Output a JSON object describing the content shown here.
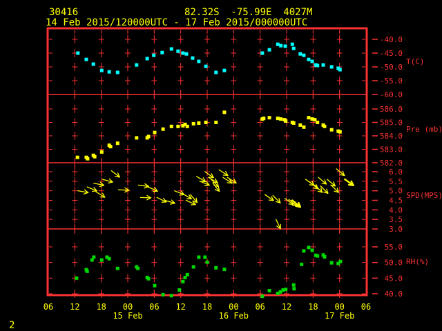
{
  "header": {
    "station_id": "30416",
    "location": "82.32S  -75.99E  4027M",
    "period": "14 Feb 2015/120000UTC - 17 Feb 2015/000000UTC"
  },
  "footer": {
    "page_label": "2"
  },
  "colors": {
    "background": "#000000",
    "axis": "#fa3232",
    "text": "#ffff00",
    "temperature": "#00ffff",
    "pressure": "#ffff00",
    "wind": "#ffff00",
    "rh": "#00d800"
  },
  "x_axis": {
    "hour_start": 6,
    "hour_end": 78,
    "hour_step": 6,
    "tick_labels": [
      "06",
      "12",
      "18",
      "00",
      "06",
      "12",
      "18",
      "00",
      "06",
      "12",
      "18",
      "00",
      "06"
    ],
    "date_labels": [
      {
        "label": "15 Feb",
        "hour": 24
      },
      {
        "label": "16 Feb",
        "hour": 48
      },
      {
        "label": "17 Feb",
        "hour": 72
      }
    ]
  },
  "chart_data": [
    {
      "type": "scatter",
      "name": "temperature",
      "label": "T(C)",
      "color_key": "temperature",
      "units": "deg C",
      "x_unit": "hours since 14 Feb 2015 00UTC",
      "tick_values": [
        -40,
        -45,
        -50,
        -55,
        -60
      ],
      "tick_labels": [
        "-40.0",
        "-45.0",
        "-50.0",
        "-55.0",
        "-60.0"
      ],
      "points": [
        [
          12.7,
          -45.0
        ],
        [
          14.6,
          -47.3
        ],
        [
          16.2,
          -49.0
        ],
        [
          18.1,
          -51.3
        ],
        [
          19.8,
          -51.8
        ],
        [
          21.7,
          -52.0
        ],
        [
          26.0,
          -49.3
        ],
        [
          28.4,
          -47.0
        ],
        [
          29.9,
          -45.8
        ],
        [
          31.8,
          -44.8
        ],
        [
          33.9,
          -43.5
        ],
        [
          35.4,
          -44.3
        ],
        [
          36.5,
          -45.0
        ],
        [
          37.3,
          -45.3
        ],
        [
          38.7,
          -46.8
        ],
        [
          40.1,
          -48.0
        ],
        [
          41.7,
          -49.8
        ],
        [
          44.0,
          -52.0
        ],
        [
          45.9,
          -51.3
        ],
        [
          54.5,
          -45.0
        ],
        [
          56.1,
          -43.8
        ],
        [
          58.0,
          -41.8
        ],
        [
          58.7,
          -42.3
        ],
        [
          59.7,
          -42.5
        ],
        [
          61.3,
          -41.8
        ],
        [
          61.6,
          -43.3
        ],
        [
          63.1,
          -45.3
        ],
        [
          63.9,
          -45.8
        ],
        [
          65.0,
          -47.3
        ],
        [
          65.8,
          -48.0
        ],
        [
          66.6,
          -49.3
        ],
        [
          67.0,
          -49.5
        ],
        [
          68.3,
          -49.3
        ],
        [
          70.2,
          -50.0
        ],
        [
          71.7,
          -50.5
        ],
        [
          72.1,
          -51.0
        ]
      ]
    },
    {
      "type": "scatter",
      "name": "pressure",
      "label": "Pre (mb)",
      "color_key": "pressure",
      "units": "mb",
      "x_unit": "hours since 14 Feb 2015 00UTC",
      "tick_values": [
        586,
        585,
        584,
        583,
        582
      ],
      "tick_labels": [
        "586.0",
        "585.0",
        "584.0",
        "583.0",
        "582.0"
      ],
      "points": [
        [
          12.6,
          582.4
        ],
        [
          14.6,
          582.4
        ],
        [
          14.9,
          582.3
        ],
        [
          16.2,
          582.55
        ],
        [
          16.5,
          582.45
        ],
        [
          18.1,
          582.8
        ],
        [
          19.8,
          583.3
        ],
        [
          20.1,
          583.2
        ],
        [
          21.7,
          583.45
        ],
        [
          26.0,
          583.85
        ],
        [
          28.4,
          583.85
        ],
        [
          28.7,
          583.95
        ],
        [
          30.1,
          584.25
        ],
        [
          32.0,
          584.5
        ],
        [
          33.9,
          584.7
        ],
        [
          35.4,
          584.7
        ],
        [
          36.5,
          584.75
        ],
        [
          37.0,
          584.85
        ],
        [
          37.5,
          584.7
        ],
        [
          38.9,
          584.9
        ],
        [
          40.1,
          584.95
        ],
        [
          41.7,
          585.0
        ],
        [
          44.0,
          585.0
        ],
        [
          45.9,
          585.75
        ],
        [
          54.5,
          585.25
        ],
        [
          54.8,
          585.3
        ],
        [
          56.1,
          585.35
        ],
        [
          58.0,
          585.3
        ],
        [
          58.7,
          585.25
        ],
        [
          59.5,
          585.2
        ],
        [
          59.8,
          585.1
        ],
        [
          61.3,
          585.0
        ],
        [
          61.6,
          584.95
        ],
        [
          63.1,
          584.8
        ],
        [
          63.9,
          584.65
        ],
        [
          65.0,
          585.35
        ],
        [
          65.8,
          585.25
        ],
        [
          66.4,
          585.2
        ],
        [
          67.0,
          585.0
        ],
        [
          68.3,
          584.8
        ],
        [
          68.6,
          584.7
        ],
        [
          70.2,
          584.45
        ],
        [
          71.7,
          584.35
        ],
        [
          72.1,
          584.3
        ]
      ]
    },
    {
      "type": "quiver",
      "name": "wind_speed",
      "label": "SPD(MPS)",
      "color_key": "wind",
      "units": "m/s",
      "x_unit": "hours since 14 Feb 2015 00UTC",
      "angle_unit": "degrees clockwise from screen-right",
      "tick_values": [
        6,
        5.5,
        5,
        4.5,
        4,
        3.5,
        3
      ],
      "tick_labels": [
        "6.0",
        "5.5",
        "5.0",
        "4.5",
        "4.0",
        "3.5",
        "3.0"
      ],
      "arrows": [
        [
          12.7,
          5.0,
          10,
          0
        ],
        [
          14.8,
          5.2,
          22,
          0
        ],
        [
          16.3,
          5.4,
          12,
          0
        ],
        [
          16.8,
          4.95,
          32,
          0
        ],
        [
          18.3,
          5.6,
          15,
          0
        ],
        [
          20.3,
          6.05,
          38,
          0
        ],
        [
          21.9,
          5.05,
          2,
          0
        ],
        [
          26.4,
          5.3,
          8,
          0
        ],
        [
          26.9,
          4.65,
          2,
          0
        ],
        [
          28.6,
          5.2,
          24,
          0
        ],
        [
          30.6,
          4.65,
          26,
          0
        ],
        [
          32.4,
          4.5,
          16,
          0
        ],
        [
          34.6,
          5.0,
          22,
          0
        ],
        [
          36.4,
          4.85,
          30,
          0
        ],
        [
          37.2,
          4.5,
          24,
          0
        ],
        [
          38.2,
          4.8,
          50,
          0
        ],
        [
          39.6,
          5.75,
          30,
          0
        ],
        [
          40.3,
          5.5,
          22,
          0
        ],
        [
          41.5,
          6.0,
          35,
          0
        ],
        [
          42.3,
          5.7,
          30,
          0
        ],
        [
          42.9,
          5.6,
          45,
          0
        ],
        [
          43.3,
          5.4,
          52,
          0
        ],
        [
          44.7,
          6.1,
          33,
          0
        ],
        [
          45.6,
          5.7,
          33,
          0
        ],
        [
          46.6,
          5.7,
          33,
          0
        ],
        [
          55.1,
          4.8,
          35,
          0
        ],
        [
          56.9,
          4.75,
          45,
          0
        ],
        [
          57.6,
          3.5,
          65,
          0
        ],
        [
          59.6,
          4.6,
          36,
          0
        ],
        [
          60.5,
          4.55,
          40,
          0
        ],
        [
          61.3,
          4.5,
          40,
          1
        ],
        [
          64.3,
          5.6,
          35,
          0
        ],
        [
          65.3,
          5.45,
          40,
          0
        ],
        [
          66.4,
          5.3,
          45,
          0
        ],
        [
          67.2,
          5.7,
          40,
          0
        ],
        [
          67.7,
          5.25,
          45,
          0
        ],
        [
          69.2,
          5.6,
          40,
          0
        ],
        [
          70.1,
          5.3,
          45,
          0
        ],
        [
          71.3,
          6.15,
          40,
          0
        ],
        [
          73.2,
          5.6,
          35,
          1
        ]
      ]
    },
    {
      "type": "scatter",
      "name": "relative_humidity",
      "label": "RH(%)",
      "color_key": "rh",
      "units": "%",
      "x_unit": "hours since 14 Feb 2015 00UTC",
      "tick_values": [
        55,
        50,
        45,
        40
      ],
      "tick_labels": [
        "55.0",
        "50.0",
        "45.0",
        "40.0"
      ],
      "points": [
        [
          12.4,
          45.0
        ],
        [
          14.6,
          47.7
        ],
        [
          14.8,
          47.2
        ],
        [
          15.9,
          50.8
        ],
        [
          16.3,
          51.7
        ],
        [
          18.1,
          50.8
        ],
        [
          19.3,
          51.7
        ],
        [
          19.8,
          51.2
        ],
        [
          21.7,
          48.1
        ],
        [
          26.0,
          48.6
        ],
        [
          26.3,
          48.1
        ],
        [
          28.4,
          45.2
        ],
        [
          28.7,
          44.8
        ],
        [
          30.1,
          42.6
        ],
        [
          32.0,
          39.7
        ],
        [
          33.9,
          39.4
        ],
        [
          35.7,
          41.2
        ],
        [
          36.5,
          43.9
        ],
        [
          37.0,
          45.2
        ],
        [
          37.5,
          46.1
        ],
        [
          38.9,
          48.6
        ],
        [
          40.1,
          51.7
        ],
        [
          41.5,
          51.7
        ],
        [
          42.0,
          50.1
        ],
        [
          44.0,
          48.3
        ],
        [
          45.9,
          47.8
        ],
        [
          54.5,
          39.2
        ],
        [
          56.1,
          41.0
        ],
        [
          58.0,
          40.1
        ],
        [
          58.6,
          40.6
        ],
        [
          59.2,
          41.2
        ],
        [
          59.8,
          41.4
        ],
        [
          61.6,
          42.8
        ],
        [
          61.7,
          41.6
        ],
        [
          63.4,
          49.4
        ],
        [
          63.9,
          53.7
        ],
        [
          65.0,
          54.8
        ],
        [
          65.8,
          53.9
        ],
        [
          66.6,
          52.3
        ],
        [
          67.0,
          52.1
        ],
        [
          68.3,
          52.4
        ],
        [
          68.6,
          51.8
        ],
        [
          70.2,
          49.9
        ],
        [
          71.7,
          49.7
        ],
        [
          72.2,
          50.3
        ]
      ]
    }
  ]
}
